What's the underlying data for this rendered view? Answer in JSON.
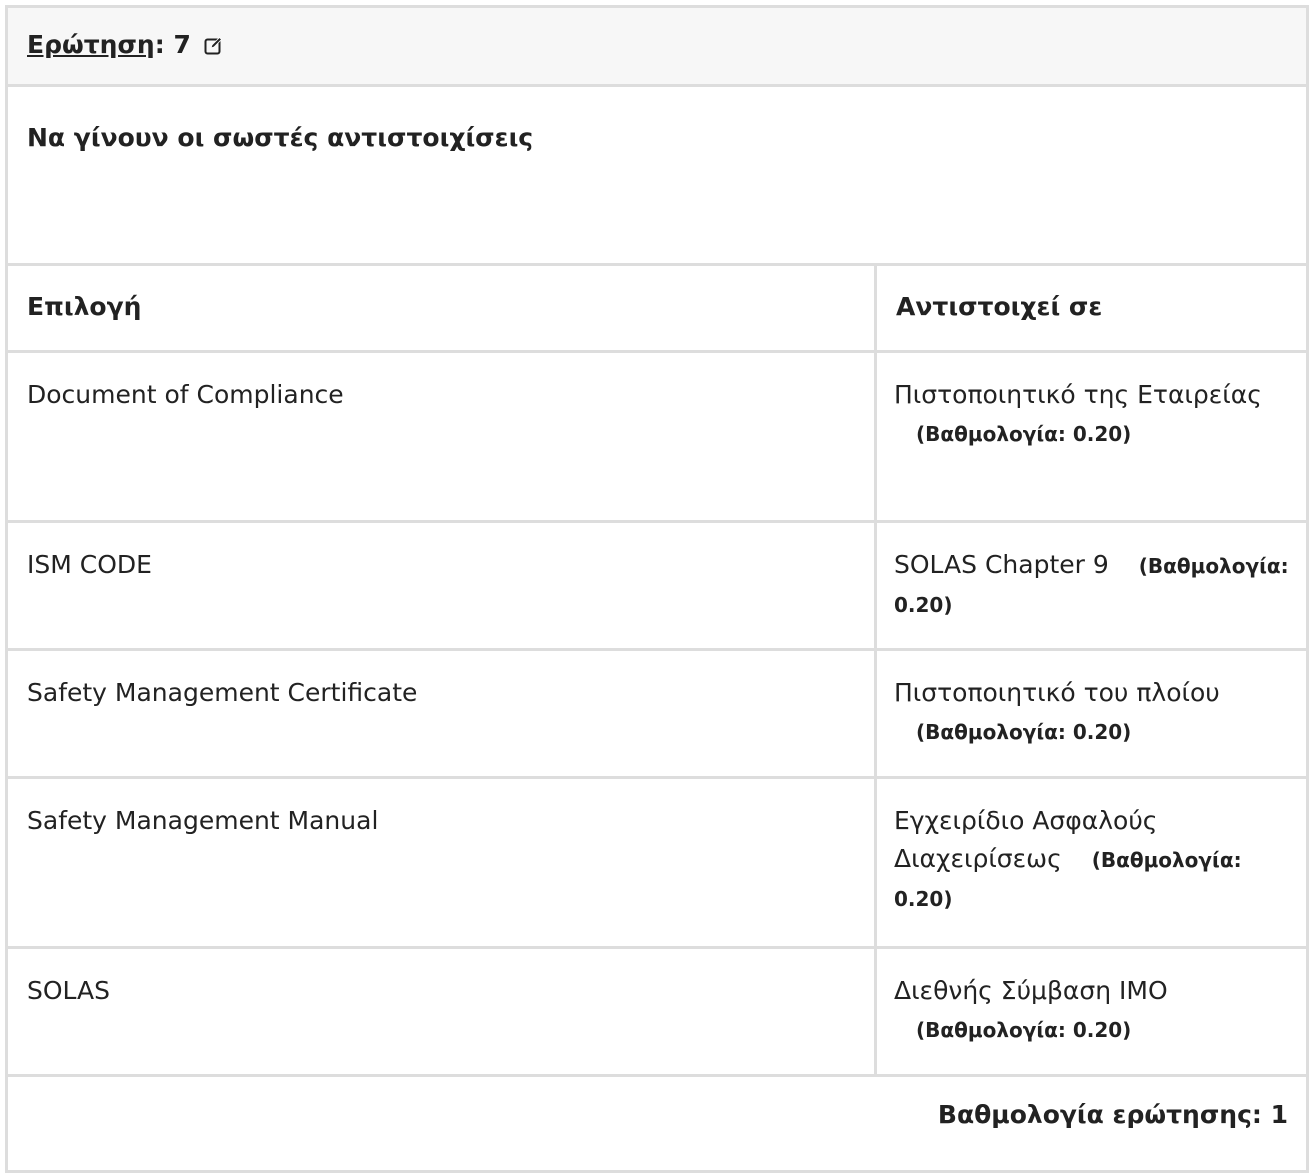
{
  "header": {
    "question_label": "Ερώτηση",
    "colon": ":",
    "number": "7",
    "edit_icon": "edit-icon"
  },
  "prompt": "Να γίνουν οι σωστές αντιστοιχίσεις",
  "table": {
    "col_option": "Επιλογή",
    "col_match": "Αντιστοιχεί σε",
    "rows": [
      {
        "option": "Document of Compliance",
        "match": "Πιστοποιητικό της Εταιρείας",
        "score": "(Βαθμολογία: 0.20)"
      },
      {
        "option": "ISM CODE",
        "match": "SOLAS Chapter 9",
        "score": "(Βαθμολογία: 0.20)"
      },
      {
        "option": "Safety Management Certificate",
        "match": "Πιστοποιητικό του πλοίου",
        "score": "(Βαθμολογία: 0.20)"
      },
      {
        "option": "Safety Management Manual",
        "match": "Εγχειρίδιο Ασφαλούς Διαχειρίσεως",
        "score": "(Βαθμολογία: 0.20)"
      },
      {
        "option": "SOLAS",
        "match": "Διεθνής Σύμβαση IMO",
        "score": "(Βαθμολογία: 0.20)"
      }
    ]
  },
  "footer": {
    "total_score": "Βαθμολογία ερώτησης: 1"
  }
}
